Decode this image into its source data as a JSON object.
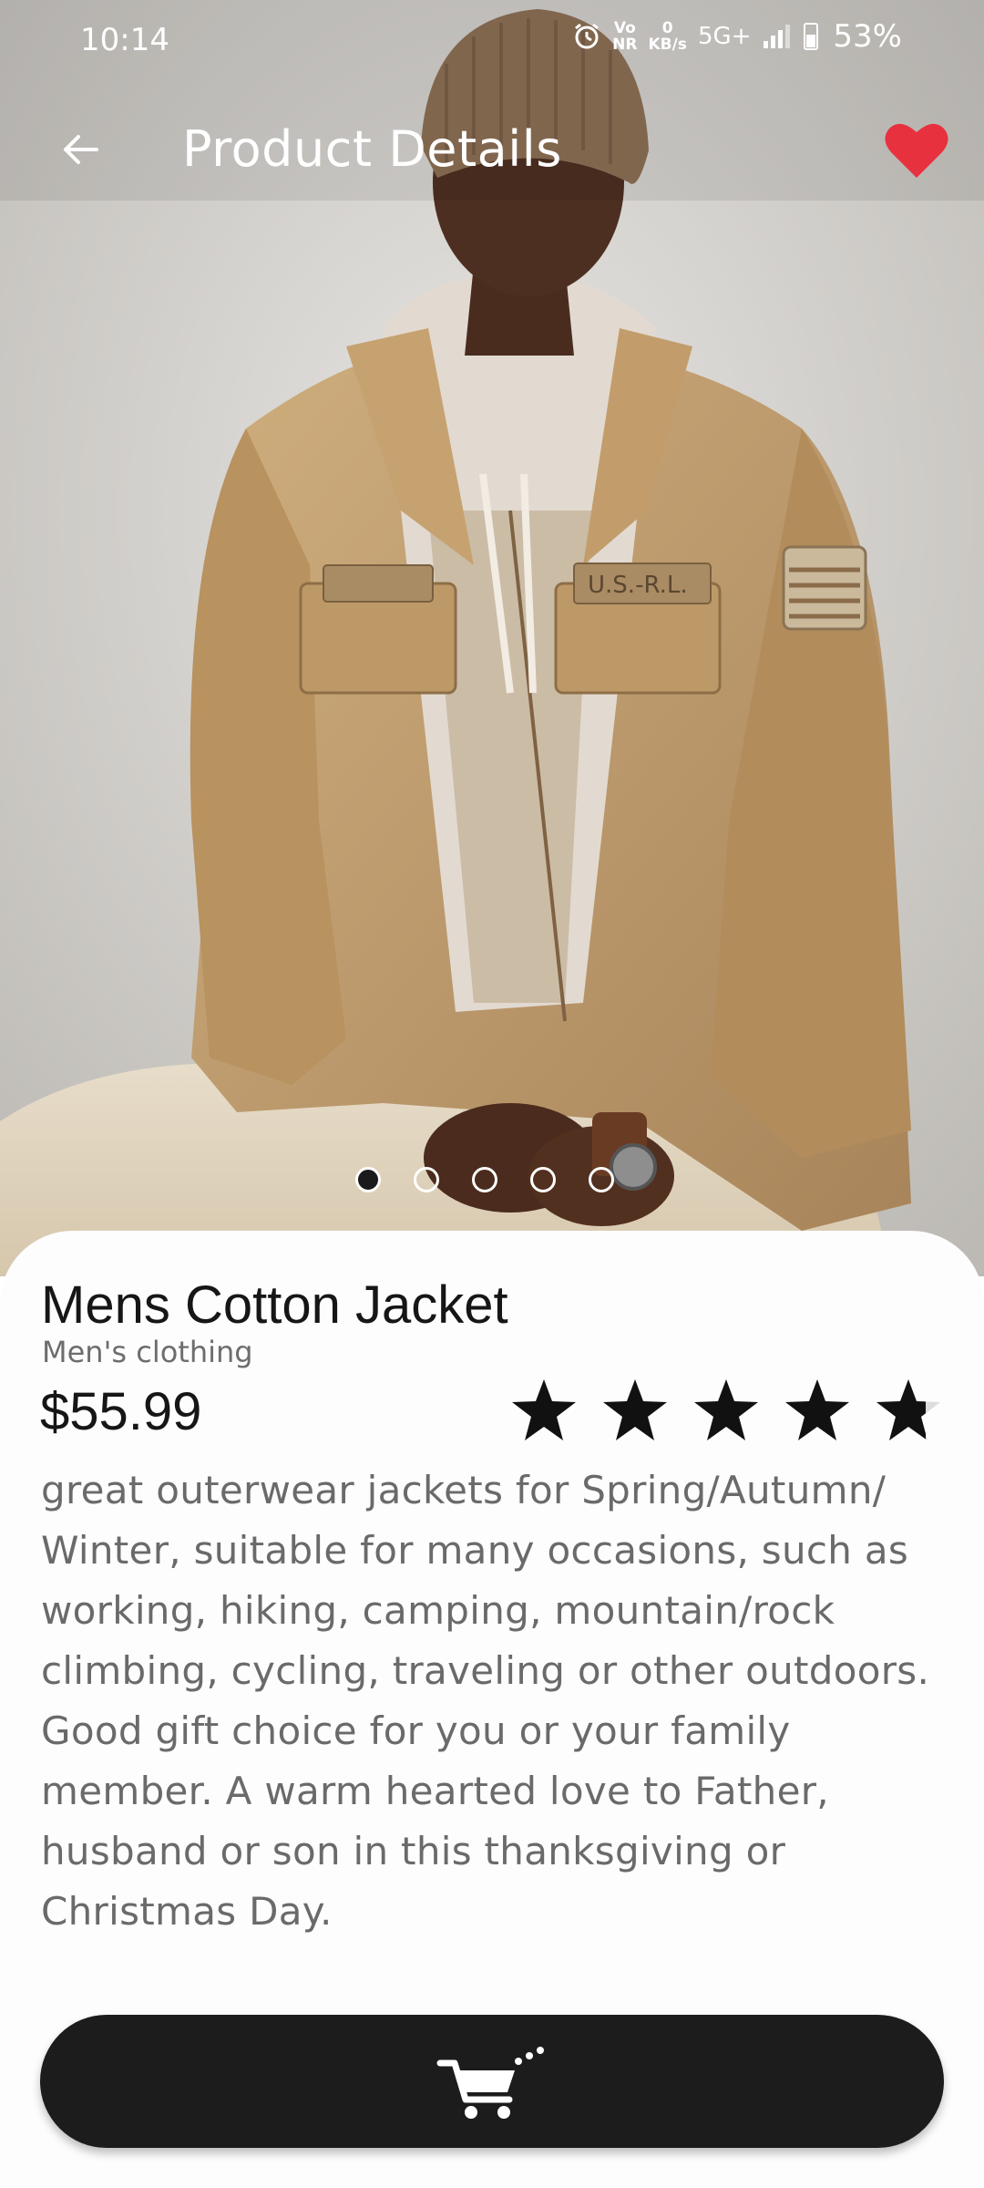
{
  "status_bar": {
    "time": "10:14",
    "network_top": "0",
    "network_unit": "KB/s",
    "network_type": "5G+",
    "volte": "Vo",
    "volte_sub": "NR",
    "battery_percent": "53%"
  },
  "app_bar": {
    "title": "Product Details",
    "back_icon": "arrow-left-icon",
    "favorite_icon": "heart-icon",
    "favorite_color": "#e8313f",
    "favorited": true
  },
  "carousel": {
    "image_count": 5,
    "active_index": 0
  },
  "product": {
    "name": "Mens Cotton Jacket",
    "category": "Men's clothing",
    "price": "$55.99",
    "rating": 4.7,
    "rating_max": 5,
    "description": "great outerwear jackets for Spring/Autumn/ Winter, suitable for many occasions, such as working, hiking, camping, mountain/rock climbing, cycling, traveling or other outdoors. Good gift choice for you or your family member. A warm hearted love to Father, husband or son in this thanksgiving or Christmas Day."
  },
  "cart_button": {
    "icon": "add-to-cart-icon",
    "background": "#1c1c1c"
  },
  "colors": {
    "card_background": "#fdfdfd",
    "text_primary": "#161616",
    "text_secondary": "#6a6a6a",
    "star_color": "#111111"
  },
  "hero_image": {
    "patch_left_text": "",
    "patch_right_text": "U.S.-R.L."
  }
}
